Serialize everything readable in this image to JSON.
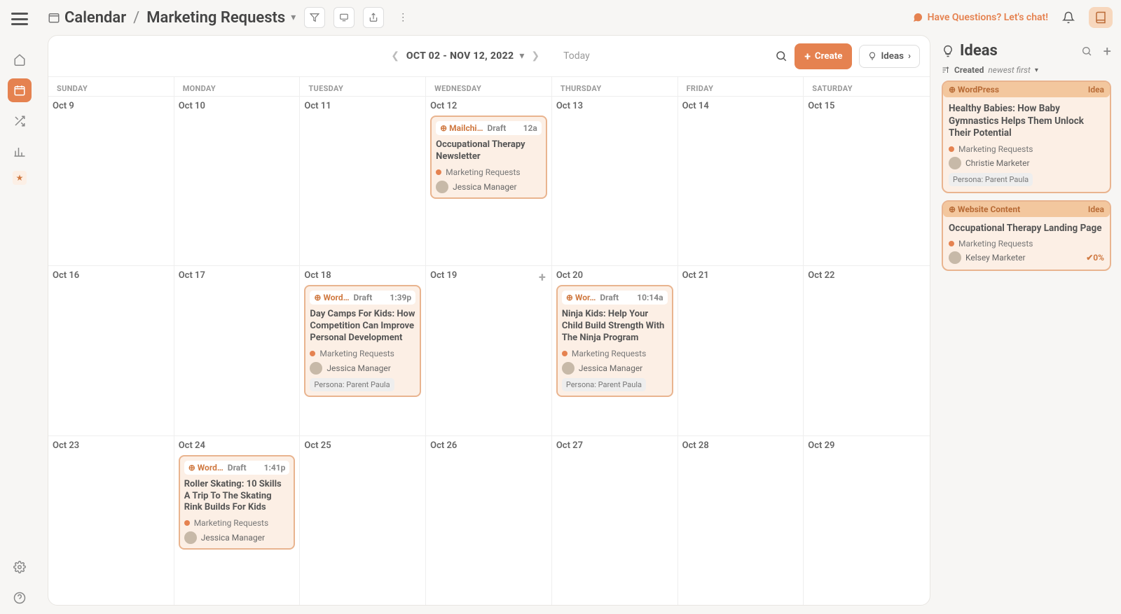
{
  "header": {
    "crumb_root": "Calendar",
    "crumb_sub": "Marketing Requests",
    "chat_cta": "Have Questions? Let's chat!"
  },
  "calendar": {
    "range": "OCT 02 - NOV 12, 2022",
    "today_label": "Today",
    "create_label": "Create",
    "ideas_label": "Ideas",
    "day_names": [
      "SUNDAY",
      "MONDAY",
      "TUESDAY",
      "WEDNESDAY",
      "THURSDAY",
      "FRIDAY",
      "SATURDAY"
    ],
    "weeks": [
      {
        "dates": [
          "Oct 9",
          "Oct 10",
          "Oct 11",
          "Oct 12",
          "Oct 13",
          "Oct 14",
          "Oct 15"
        ],
        "events": [
          {
            "col": 3,
            "source": "Mailchi…",
            "status": "Draft",
            "time": "12a",
            "title": "Occupational Therapy Newsletter",
            "project": "Marketing Requests",
            "assignee": "Jessica Manager"
          }
        ]
      },
      {
        "dates": [
          "Oct 16",
          "Oct 17",
          "Oct 18",
          "Oct 19",
          "Oct 20",
          "Oct 21",
          "Oct 22"
        ],
        "add_col": 3,
        "events": [
          {
            "col": 2,
            "source": "Word…",
            "status": "Draft",
            "time": "1:39p",
            "title": "Day Camps For Kids: How Competition Can Improve Personal Development",
            "project": "Marketing Requests",
            "assignee": "Jessica Manager",
            "persona": "Persona: Parent Paula"
          },
          {
            "col": 4,
            "source": "Wor…",
            "status": "Draft",
            "time": "10:14a",
            "title": "Ninja Kids: Help Your Child Build Strength With The Ninja Program",
            "project": "Marketing Requests",
            "assignee": "Jessica Manager",
            "persona": "Persona: Parent Paula"
          }
        ]
      },
      {
        "dates": [
          "Oct 23",
          "Oct 24",
          "Oct 25",
          "Oct 26",
          "Oct 27",
          "Oct 28",
          "Oct 29"
        ],
        "events": [
          {
            "col": 1,
            "source": "Word…",
            "status": "Draft",
            "time": "1:41p",
            "title": "Roller Skating: 10 Skills A Trip To The Skating Rink Builds For Kids",
            "project": "Marketing Requests",
            "assignee": "Jessica Manager"
          }
        ]
      }
    ]
  },
  "ideas": {
    "panel_title": "Ideas",
    "sort_label": "Created",
    "sort_value": "newest first",
    "items": [
      {
        "source": "WordPress",
        "kind": "Idea",
        "title": "Healthy Babies: How Baby Gymnastics Helps Them Unlock Their Potential",
        "project": "Marketing Requests",
        "assignee": "Christie Marketer",
        "persona": "Persona: Parent Paula"
      },
      {
        "source": "Website Content",
        "kind": "Idea",
        "title": "Occupational Therapy Landing Page",
        "project": "Marketing Requests",
        "assignee": "Kelsey Marketer",
        "pct": "0%"
      }
    ]
  }
}
